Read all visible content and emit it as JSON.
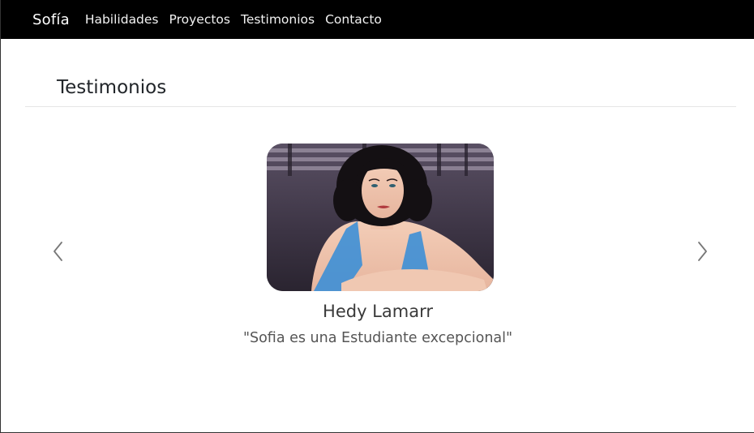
{
  "navbar": {
    "brand": "Sofía",
    "links": [
      "Habilidades",
      "Proyectos",
      "Testimonios",
      "Contacto"
    ]
  },
  "section": {
    "title": "Testimonios"
  },
  "testimonial": {
    "name": "Hedy Lamarr",
    "quote": "\"Sofia es una Estudiante excepcional\""
  },
  "controls": {
    "prev_icon": "chevron-left-icon",
    "next_icon": "chevron-right-icon"
  },
  "colors": {
    "navbar_bg": "#000000",
    "nav_text": "#ffffff",
    "page_bg": "#ffffff"
  }
}
